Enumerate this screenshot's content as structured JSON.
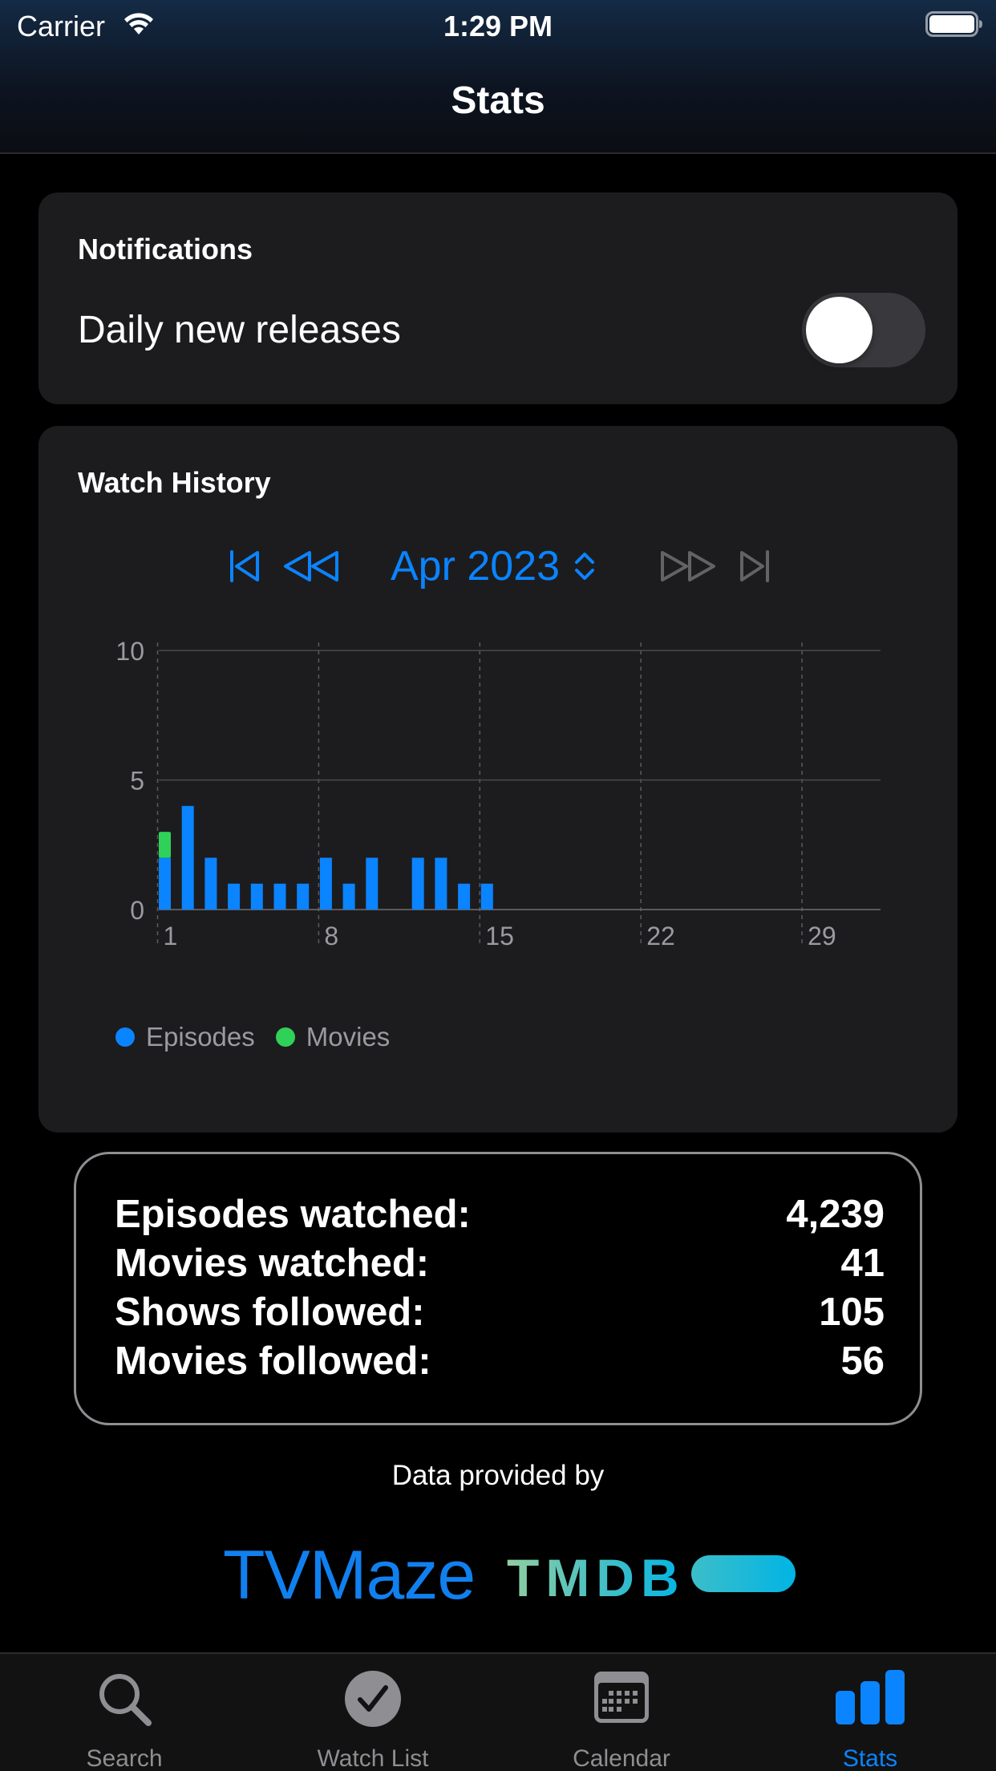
{
  "status_bar": {
    "carrier": "Carrier",
    "time": "1:29 PM"
  },
  "nav": {
    "title": "Stats"
  },
  "notifications": {
    "section_title": "Notifications",
    "setting_label": "Daily new releases",
    "enabled": false
  },
  "watch_history": {
    "section_title": "Watch History",
    "month": "Apr 2023",
    "nav_icons": [
      "skip-to-first-icon",
      "rewind-icon",
      "fast-forward-icon",
      "skip-to-last-icon"
    ]
  },
  "chart_data": {
    "type": "bar",
    "stacked": true,
    "title": "",
    "xlabel": "",
    "ylabel": "",
    "ylim": [
      0,
      12
    ],
    "xlim": [
      0.5,
      31
    ],
    "y_ticks": [
      0,
      5,
      10
    ],
    "x_ticks": [
      1,
      8,
      15,
      22,
      29
    ],
    "x": [
      1,
      2,
      3,
      4,
      5,
      6,
      7,
      8,
      9,
      10,
      12,
      13,
      14,
      15
    ],
    "series": [
      {
        "name": "Episodes",
        "color": "#0a84ff",
        "values": [
          2,
          4,
          2,
          1,
          1,
          1,
          1,
          2,
          1,
          2,
          2,
          2,
          1,
          1
        ]
      },
      {
        "name": "Movies",
        "color": "#30d158",
        "values": [
          1,
          0,
          0,
          0,
          0,
          0,
          0,
          0,
          0,
          0,
          0,
          0,
          0,
          0
        ]
      }
    ],
    "grid": true,
    "legend": "bottom-left"
  },
  "totals": {
    "episodes_label": "Episodes watched:",
    "episodes_value": "4,239",
    "movies_label": "Movies watched:",
    "movies_value": "41",
    "shows_followed_label": "Shows followed:",
    "shows_followed_value": "105",
    "movies_followed_label": "Movies followed:",
    "movies_followed_value": "56"
  },
  "credits": {
    "provided_by": "Data provided by",
    "tvmaze": "TVMaze",
    "tmdb": "TMDB"
  },
  "tabs": [
    {
      "label": "Search",
      "icon": "search-icon",
      "active": false
    },
    {
      "label": "Watch List",
      "icon": "checkmark-circle-icon",
      "active": false
    },
    {
      "label": "Calendar",
      "icon": "calendar-icon",
      "active": false
    },
    {
      "label": "Stats",
      "icon": "bar-chart-icon",
      "active": true
    }
  ],
  "colors": {
    "accent": "#0a84ff",
    "episodes": "#0a84ff",
    "movies": "#30d158",
    "card": "#1c1c1e"
  }
}
